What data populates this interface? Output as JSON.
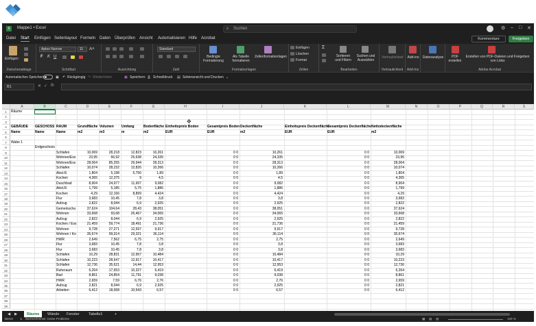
{
  "title_bar": {
    "doc_title": "Mappe1 • Excel",
    "search_placeholder": "Suchen"
  },
  "menu": {
    "tabs": [
      "Datei",
      "Start",
      "Einfügen",
      "Seitenlayout",
      "Formeln",
      "Daten",
      "Überprüfen",
      "Ansicht",
      "Automatisieren",
      "Hilfe",
      "Acrobat"
    ],
    "active": "Start",
    "kommentare": "Kommentare",
    "freigeben": "Freigeben"
  },
  "ribbon": {
    "groups": [
      "Zwischenablage",
      "Schriftart",
      "Ausrichtung",
      "Zahl",
      "Formatvorlagen",
      "Zellen",
      "Bearbeiten",
      "Vertraulichkeit",
      "Add-Ins",
      "",
      "Adobe Acrobat"
    ],
    "einfuegen": "Einfügen",
    "font_name": "Aptos Narrow",
    "font_size": "11",
    "number_format": "Standard",
    "bedingte": "Bedingte Formatierung",
    "als_tabelle": "Als Tabelle formatieren",
    "zellformat": "Zellenformatvorlagen",
    "zellen_items": [
      "Einfügen",
      "Löschen",
      "Format"
    ],
    "sortieren": "Sortieren und Filtern",
    "suchen": "Suchen und Auswählen",
    "vertraulichkeit": "Vertraulichkeit",
    "addins": "Add-ins",
    "datenanalyse": "Datenanalyse",
    "pdf_erstellen": "PDF erstellen",
    "pdf_links": "Erstellen von PDF-Dateien und Freigeben von Links"
  },
  "quick_access": {
    "autosave": "Automatisches Speichern",
    "undo": "Rückgängig",
    "redo": "Wiederholen",
    "save": "Speichern",
    "quickprint": "Schnelldruck",
    "pageview": "Seitenansicht und Drucken"
  },
  "formula_bar": {
    "cell": "B1",
    "fx": "fx",
    "content": ""
  },
  "grid": {
    "columns": [
      "A",
      "B",
      "C",
      "D",
      "E",
      "F",
      "G",
      "H",
      "I",
      "J",
      "K",
      "L",
      "M",
      "N",
      "O",
      "P",
      "Q",
      "R",
      "S"
    ],
    "selected_column": "B",
    "selected_cell": "B1",
    "row_numbers": [
      "1",
      "2",
      "3",
      "4",
      "5",
      "6",
      "7",
      "8",
      "9",
      "10",
      "11",
      "12",
      "13",
      "14",
      "15",
      "16",
      "17",
      "18",
      "19",
      "20",
      "21",
      "22",
      "23",
      "24",
      "25",
      "26",
      "27",
      "28",
      "29",
      "30",
      "31",
      "32",
      "33",
      "34",
      "35",
      "36",
      "37",
      "38",
      "39"
    ],
    "title_row": {
      "a": "Räume"
    },
    "header_row4": [
      "GEBÄUDE",
      "GESCHOSS",
      "RAUM",
      "Grundfläche",
      "Volumen",
      "Umfang",
      "Bodenfläche",
      "Einheitspreis Boden",
      "Gesamtpreis Boden",
      "Deckenfläche",
      "Einheitspreis Deckenfläche",
      "Gesamtpreis Deckenfläche",
      "Nettodeckenfläche"
    ],
    "header_row5": [
      "Name",
      "Name",
      "Name",
      "m2",
      "m3",
      "m",
      "m2",
      "EUR",
      "EUR",
      "m2",
      "EUR",
      "EUR",
      "m2"
    ],
    "wabe": "Wabe 1",
    "erdgeschoss": "Erdgeschoss",
    "data_rows": [
      [
        "Schlafen",
        "10,069",
        "28,218",
        "12,823",
        "10,261",
        "0 0",
        "10,261",
        "0 0",
        "10,069"
      ],
      [
        "Wohnen/Ess",
        "23,95",
        "66,92",
        "25,638",
        "24,335",
        "0 0",
        "24,335",
        "0 0",
        "23,95"
      ],
      [
        "Wohnen/Ess",
        "28,064",
        "85,255",
        "29,944",
        "28,313",
        "0 0",
        "28,313",
        "0 0",
        "28,064"
      ],
      [
        "Schlafen",
        "10,074",
        "28,232",
        "12,826",
        "10,266",
        "0 0",
        "10,266",
        "0 0",
        "10,074"
      ],
      [
        "Abst.R.",
        "1,804",
        "5,198",
        "5,756",
        "1,89",
        "0 0",
        "1,89",
        "0 0",
        "1,804"
      ],
      [
        "Kochen",
        "4,365",
        "12,375",
        "9",
        "4,5",
        "0 0",
        "4,5",
        "0 0",
        "4,365"
      ],
      [
        "Duschbad",
        "8,904",
        "24,977",
        "11,907",
        "9,082",
        "0 0",
        "9,082",
        "0 0",
        "8,904"
      ],
      [
        "Abst.R.",
        "1,799",
        "5,185",
        "5,75",
        "1,886",
        "0 0",
        "1,886",
        "0 0",
        "1,799"
      ],
      [
        "Kochen",
        "4,29",
        "12,166",
        "8,899",
        "4,424",
        "0 0",
        "4,424",
        "0 0",
        "4,29"
      ],
      [
        "Flur",
        "3,683",
        "10,45",
        "7,8",
        "3,8",
        "0 0",
        "3,8",
        "0 0",
        "3,683"
      ],
      [
        "Aufzug",
        "2,822",
        "8,044",
        "6,9",
        "2,925",
        "0 0",
        "2,925",
        "0 0",
        "2,822"
      ],
      [
        "Gemeinscha",
        "37,624",
        "104,64",
        "28,43",
        "38,051",
        "0 0",
        "38,051",
        "0 0",
        "37,624"
      ],
      [
        "Wohnen",
        "33,668",
        "93,68",
        "26,467",
        "34,065",
        "0 0",
        "34,065",
        "0 0",
        "33,668"
      ],
      [
        "Aufzug",
        "2,822",
        "8,044",
        "6,9",
        "2,925",
        "0 0",
        "2,925",
        "0 0",
        "2,822"
      ],
      [
        "Kochen / Ess",
        "21,459",
        "59,774",
        "18,491",
        "21,736",
        "0 0",
        "21,736",
        "0 0",
        "21,459"
      ],
      [
        "Wohnen",
        "9,728",
        "27,271",
        "12,597",
        "9,917",
        "0 0",
        "9,917",
        "0 0",
        "9,728"
      ],
      [
        "Wohnen / Ko",
        "35,674",
        "99,314",
        "29,321",
        "36,114",
        "0 0",
        "36,114",
        "0 0",
        "35,674"
      ],
      [
        "HWR",
        "2,649",
        "7,562",
        "6,75",
        "2,75",
        "0 0",
        "2,75",
        "0 0",
        "2,649"
      ],
      [
        "Flur",
        "3,683",
        "10,45",
        "7,8",
        "3,8",
        "0 0",
        "3,8",
        "0 0",
        "3,683"
      ],
      [
        "Flur",
        "3,683",
        "10,45",
        "7,8",
        "3,8",
        "0 0",
        "3,8",
        "0 0",
        "3,683"
      ],
      [
        "Schlafen",
        "10,29",
        "28,831",
        "12,957",
        "10,484",
        "0 0",
        "10,484",
        "0 0",
        "10,29"
      ],
      [
        "Schlafen",
        "10,223",
        "28,647",
        "12,917",
        "10,417",
        "0 0",
        "10,417",
        "0 0",
        "10,223"
      ],
      [
        "Schlafen",
        "12,736",
        "35,621",
        "14,44",
        "12,953",
        "0 0",
        "12,953",
        "0 0",
        "12,736"
      ],
      [
        "Ruheraum",
        "6,264",
        "17,653",
        "10,327",
        "6,419",
        "0 0",
        "6,419",
        "0 0",
        "6,264"
      ],
      [
        "Bad",
        "8,861",
        "24,854",
        "11,791",
        "9,038",
        "0 0",
        "9,038",
        "0 0",
        "8,861"
      ],
      [
        "HWR",
        "2,659",
        "7,59",
        "6,76",
        "2,76",
        "0 0",
        "2,76",
        "0 0",
        "2,659"
      ],
      [
        "Aufzug",
        "2,821",
        "8,044",
        "6,9",
        "2,925",
        "0 0",
        "2,925",
        "0 0",
        "2,821"
      ],
      [
        "Arbeiten",
        "6,412",
        "18,068",
        "10,543",
        "6,57",
        "0 0",
        "6,57",
        "0 0",
        "6,412"
      ]
    ]
  },
  "sheets": {
    "tabs": [
      "Räume",
      "Wände",
      "Fenster",
      "Tabelle1"
    ],
    "active": "Räume",
    "add": "+"
  },
  "status": {
    "left": "Bereit",
    "accessibility": "Barrierefreiheit: Keine Probleme",
    "zoom": "100 %"
  }
}
